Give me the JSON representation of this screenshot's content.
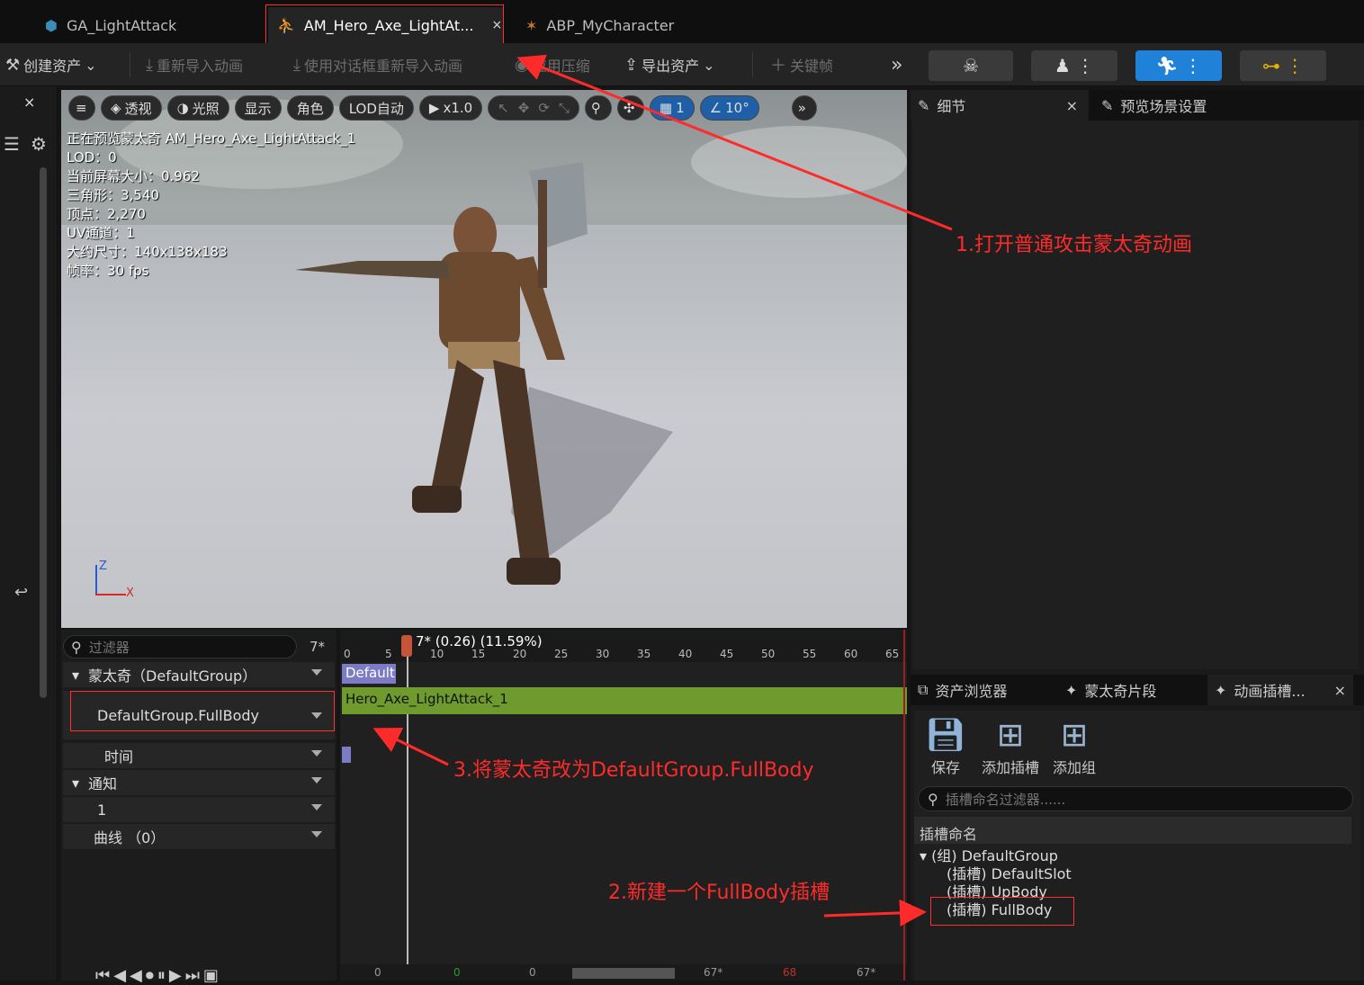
{
  "tabs": [
    {
      "label": "GA_LightAttack",
      "icon": "gameplay-ability-icon"
    },
    {
      "label": "AM_Hero_Axe_LightAt...",
      "icon": "anim-montage-icon",
      "active": true,
      "close": "×"
    },
    {
      "label": "ABP_MyCharacter",
      "icon": "anim-blueprint-icon"
    }
  ],
  "toolbar": {
    "create_asset": "创建资产",
    "reimport": "重新导入动画",
    "reimport_dialog": "使用对话框重新导入动画",
    "apply_compression": "应用压缩",
    "export_asset": "导出资产",
    "keyframe": "关键帧"
  },
  "viewport": {
    "menu": "≡",
    "perspective": "透视",
    "lighting": "光照",
    "show": "显示",
    "character": "角色",
    "lod": "LOD自动",
    "play_speed": "x1.0",
    "grid_value": "1",
    "angle_value": "10°",
    "stats": [
      "正在预览蒙太奇 AM_Hero_Axe_LightAttack_1",
      "LOD：0",
      "当前屏幕大小：0.962",
      "三角形：3,540",
      "顶点：2,270",
      "UV通道：1",
      "大约尺寸：140x138x183",
      "帧率：30 fps"
    ],
    "axis_z": "Z",
    "axis_x": "X"
  },
  "details": {
    "tab_details": "细节",
    "tab_preview": "预览场景设置",
    "close": "×"
  },
  "timeline": {
    "filter_placeholder": "过滤器",
    "frame_field": "7*",
    "montage_row": "蒙太奇（DefaultGroup）",
    "slot_row": "DefaultGroup.FullBody",
    "time_row": "时间",
    "notify_row": "通知",
    "notify_track": "1",
    "curves_row": "曲线 （0）",
    "playhead_label": "7* (0.26) (11.59%)",
    "ruler_ticks": [
      "0",
      "5",
      "10",
      "15",
      "20",
      "25",
      "30",
      "35",
      "40",
      "45",
      "50",
      "55",
      "60",
      "65"
    ],
    "section_label": "Default",
    "segment_label": "Hero_Axe_LightAttack_1",
    "bottom_values": [
      "0",
      "0",
      "0",
      "67*",
      "68",
      "67*"
    ]
  },
  "bottom_panel": {
    "tab_assets": "资产浏览器",
    "tab_montage_sections": "蒙太奇片段",
    "tab_anim_slots": "动画插槽...",
    "close": "×",
    "save": "保存",
    "add_slot": "添加插槽",
    "add_group": "添加组",
    "filter_placeholder": "插槽命名过滤器......",
    "header": "插槽命名",
    "group": "(组) DefaultGroup",
    "slots": [
      "(插槽) DefaultSlot",
      "(插槽) UpBody",
      "(插槽) FullBody"
    ]
  },
  "annotations": {
    "a1": "1.打开普通攻击蒙太奇动画",
    "a2": "2.新建一个FullBody插槽",
    "a3": "3.将蒙太奇改为DefaultGroup.FullBody"
  },
  "colors": {
    "annotation": "#ff2b2b",
    "accent": "#1f82d8",
    "segment": "#6e9a2e",
    "section": "#7c7cc4"
  }
}
